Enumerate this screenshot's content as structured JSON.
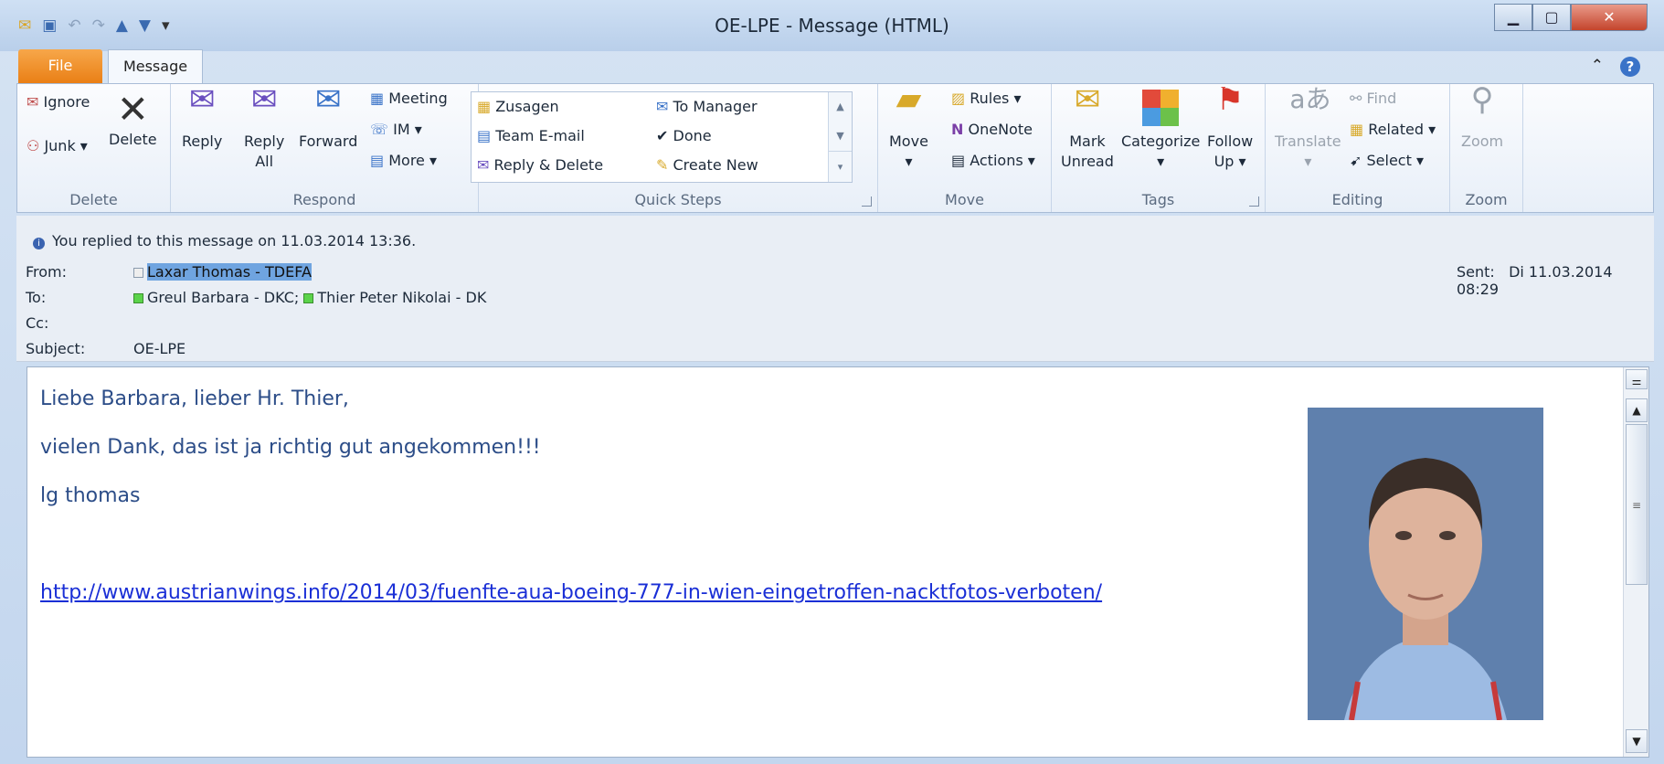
{
  "window": {
    "title": "OE-LPE  -  Message (HTML)",
    "minimize_icon": "minimize-icon",
    "maximize_icon": "maximize-icon",
    "close_icon": "close-icon"
  },
  "tabs": {
    "file": "File",
    "message": "Message"
  },
  "ribbon": {
    "delete_group": {
      "label": "Delete",
      "ignore": "Ignore",
      "junk": "Junk",
      "delete": "Delete"
    },
    "respond_group": {
      "label": "Respond",
      "reply": "Reply",
      "reply_all_1": "Reply",
      "reply_all_2": "All",
      "forward": "Forward",
      "meeting": "Meeting",
      "im": "IM",
      "more": "More"
    },
    "quicksteps_group": {
      "label": "Quick Steps",
      "items": [
        "Zusagen",
        "Team E-mail",
        "Reply & Delete",
        "To Manager",
        "Done",
        "Create New"
      ]
    },
    "move_group": {
      "label": "Move",
      "move": "Move",
      "rules": "Rules",
      "onenote": "OneNote",
      "actions": "Actions"
    },
    "tags_group": {
      "label": "Tags",
      "mark_unread_1": "Mark",
      "mark_unread_2": "Unread",
      "categorize": "Categorize",
      "follow_up_1": "Follow",
      "follow_up_2": "Up"
    },
    "editing_group": {
      "label": "Editing",
      "translate": "Translate",
      "find": "Find",
      "related": "Related",
      "select": "Select"
    },
    "zoom_group": {
      "label": "Zoom",
      "zoom": "Zoom"
    }
  },
  "header": {
    "info": "You replied to this message on 11.03.2014 13:36.",
    "from_label": "From:",
    "from": "Laxar Thomas - TDEFA",
    "to_label": "To:",
    "to_1": "Greul Barbara - DKC;",
    "to_2": "Thier Peter Nikolai - DK",
    "cc_label": "Cc:",
    "subject_label": "Subject:",
    "subject": "OE-LPE",
    "sent_label": "Sent:",
    "sent": "Di 11.03.2014 08:29"
  },
  "body": {
    "line1": "Liebe Barbara, lieber Hr. Thier,",
    "line2": "vielen Dank, das ist ja richtig gut angekommen!!!",
    "line3": "lg thomas",
    "link": "http://www.austrianwings.info/2014/03/fuenfte-aua-boeing-777-in-wien-eingetroffen-nacktfotos-verboten/"
  },
  "colors": {
    "file_tab": "#e97e14",
    "link": "#1a2fd6",
    "body_text": "#2c4d88"
  }
}
